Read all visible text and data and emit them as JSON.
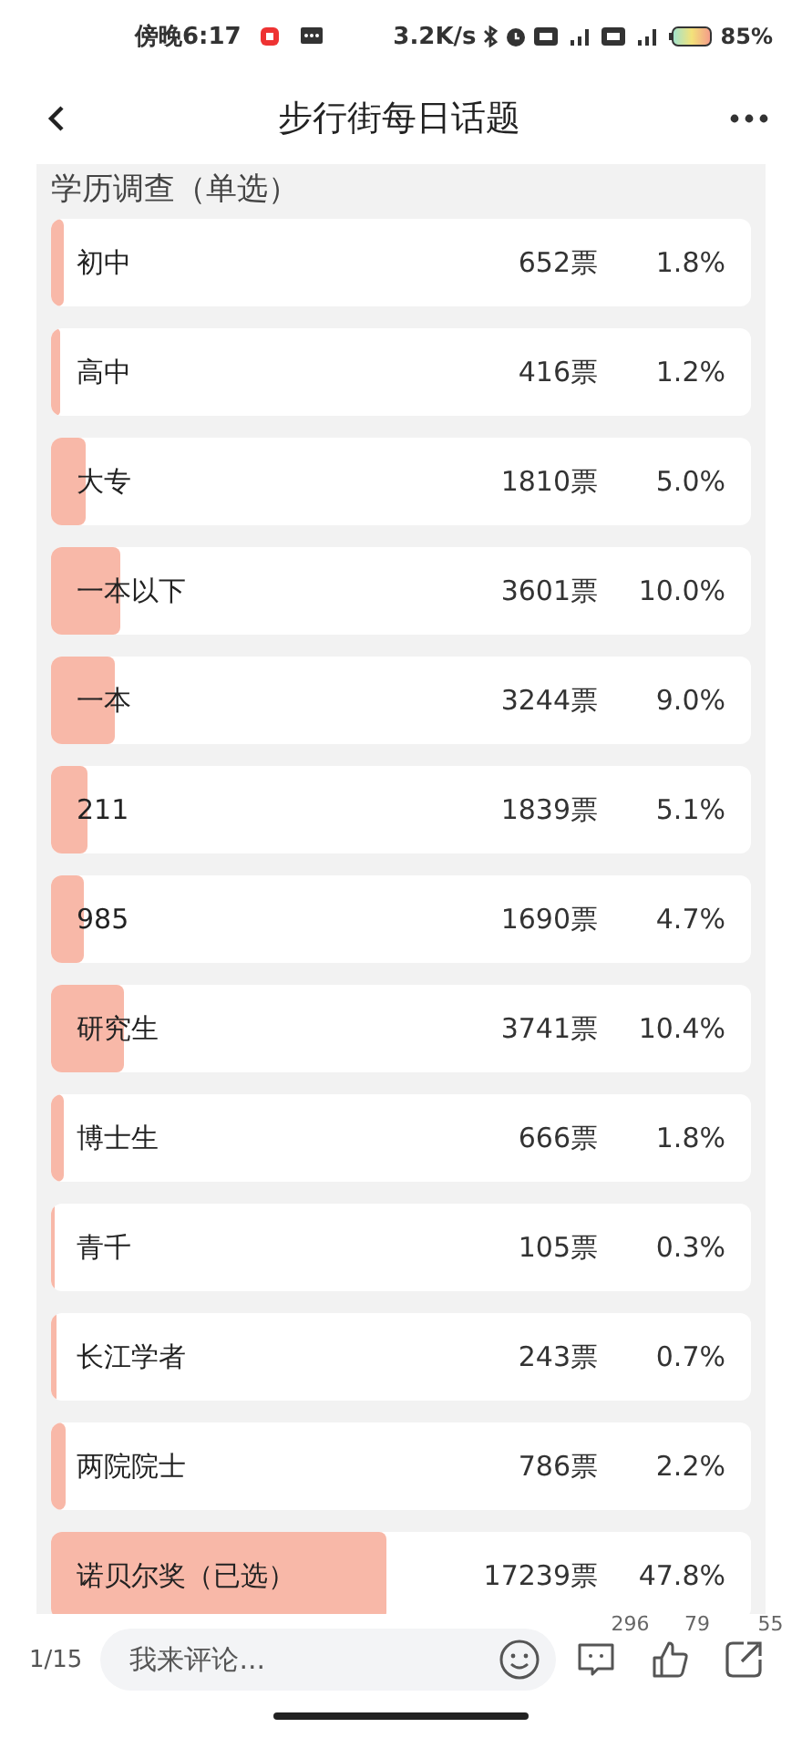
{
  "status_bar": {
    "time": "傍晚6:17",
    "speed": "3.2K/s",
    "battery": "85%"
  },
  "header": {
    "title": "步行街每日话题"
  },
  "poll": {
    "title": "学历调查（单选）",
    "options": [
      {
        "label": "初中",
        "votes": "652票",
        "percent": "1.8%",
        "level": 0.018
      },
      {
        "label": "高中",
        "votes": "416票",
        "percent": "1.2%",
        "level": 0.012
      },
      {
        "label": "大专",
        "votes": "1810票",
        "percent": "5.0%",
        "level": 0.05
      },
      {
        "label": "一本以下",
        "votes": "3601票",
        "percent": "10.0%",
        "level": 0.1
      },
      {
        "label": "一本",
        "votes": "3244票",
        "percent": "9.0%",
        "level": 0.09
      },
      {
        "label": "211",
        "votes": "1839票",
        "percent": "5.1%",
        "level": 0.051
      },
      {
        "label": "985",
        "votes": "1690票",
        "percent": "4.7%",
        "level": 0.047
      },
      {
        "label": "研究生",
        "votes": "3741票",
        "percent": "10.4%",
        "level": 0.104
      },
      {
        "label": "博士生",
        "votes": "666票",
        "percent": "1.8%",
        "level": 0.018
      },
      {
        "label": "青千",
        "votes": "105票",
        "percent": "0.3%",
        "level": 0.003
      },
      {
        "label": "长江学者",
        "votes": "243票",
        "percent": "0.7%",
        "level": 0.007
      },
      {
        "label": "两院院士",
        "votes": "786票",
        "percent": "2.2%",
        "level": 0.022
      },
      {
        "label": "诺贝尔奖（已选）",
        "votes": "17239票",
        "percent": "47.8%",
        "level": 0.478
      }
    ]
  },
  "bottom_bar": {
    "page": "1/15",
    "comment_placeholder": "我来评论...",
    "comments": "296",
    "likes": "79",
    "shares": "55"
  }
}
